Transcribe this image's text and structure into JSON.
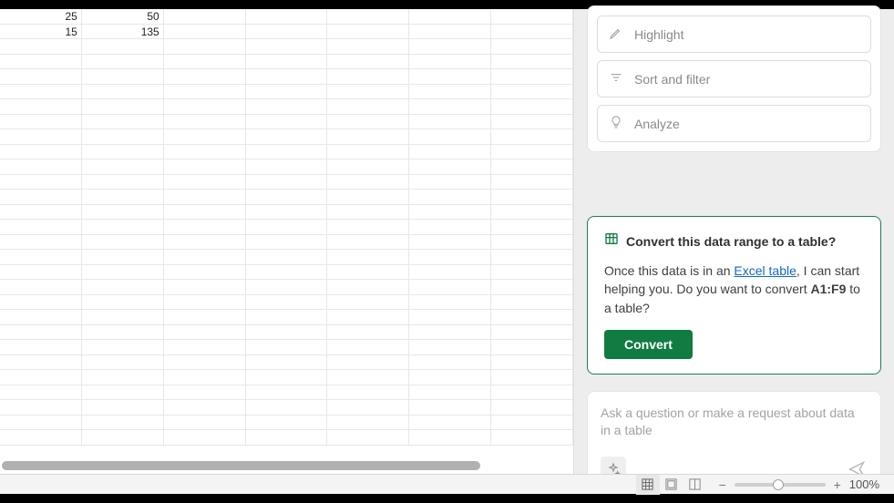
{
  "sheet": {
    "rows": [
      {
        "cells": [
          "25",
          "50",
          "",
          "",
          "",
          "",
          ""
        ]
      },
      {
        "cells": [
          "15",
          "135",
          "",
          "",
          "",
          "",
          ""
        ]
      }
    ],
    "empty_row_count": 27
  },
  "side_panel": {
    "suggestions": {
      "highlight": "Highlight",
      "sort_filter": "Sort and filter",
      "analyze": "Analyze"
    },
    "prompt_card": {
      "title": "Convert this data range to a table?",
      "body_prefix": "Once this data is in an ",
      "link_text": "Excel table",
      "body_mid": ", I can start helping you. Do you want to convert ",
      "range": "A1:F9",
      "body_suffix": " to a table?",
      "convert_button": "Convert"
    },
    "chat": {
      "placeholder": "Ask a question or make a request about data in a table"
    }
  },
  "statusbar": {
    "zoom_label": "100%"
  },
  "colors": {
    "accent_green": "#107c41",
    "card_border": "#1a7f5a",
    "link": "#1468c7"
  }
}
